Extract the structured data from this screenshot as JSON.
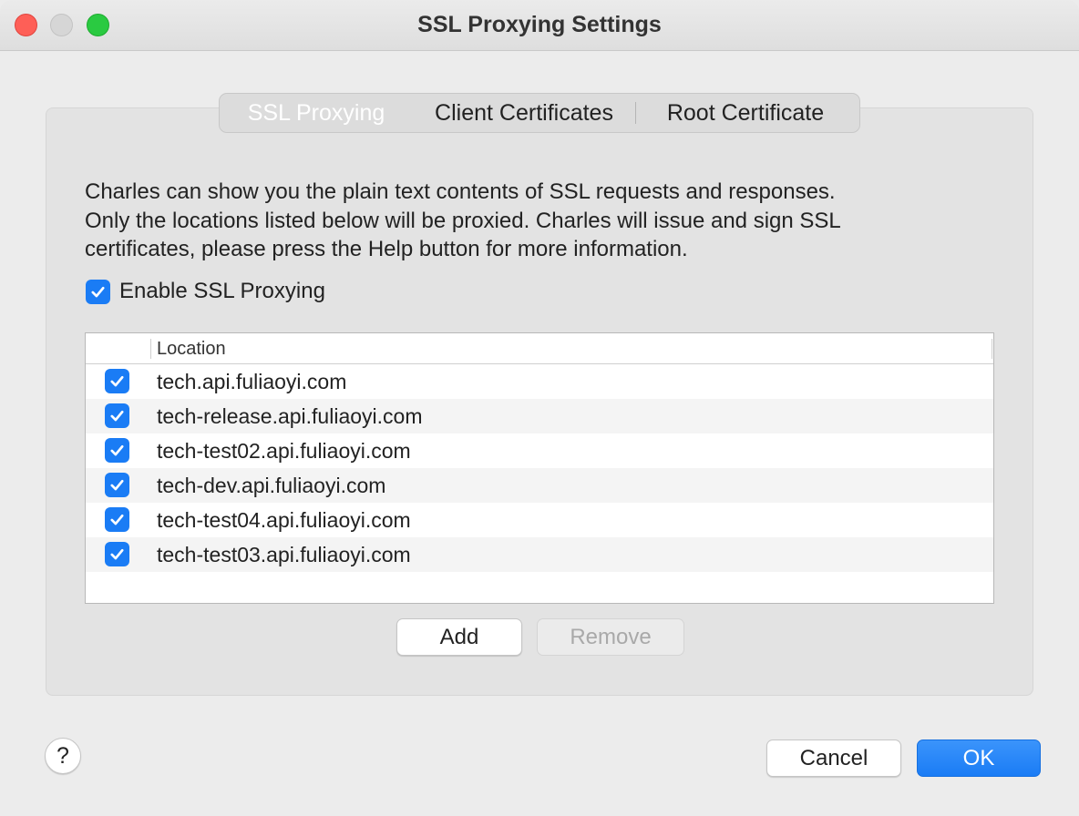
{
  "window": {
    "title": "SSL Proxying Settings"
  },
  "tabs": [
    {
      "label": "SSL Proxying",
      "active": true
    },
    {
      "label": "Client Certificates",
      "active": false
    },
    {
      "label": "Root Certificate",
      "active": false
    }
  ],
  "description": {
    "line1": "Charles can show you the plain text contents of SSL requests and responses.",
    "line2": "Only the locations listed below will be proxied. Charles will issue and sign SSL",
    "line3": "certificates, please press the Help button for more information."
  },
  "enable_ssl": {
    "label": "Enable SSL Proxying",
    "checked": true
  },
  "locations": {
    "column_header": "Location",
    "rows": [
      {
        "checked": true,
        "location": "tech.api.fuliaoyi.com"
      },
      {
        "checked": true,
        "location": "tech-release.api.fuliaoyi.com"
      },
      {
        "checked": true,
        "location": "tech-test02.api.fuliaoyi.com"
      },
      {
        "checked": true,
        "location": "tech-dev.api.fuliaoyi.com"
      },
      {
        "checked": true,
        "location": "tech-test04.api.fuliaoyi.com"
      },
      {
        "checked": true,
        "location": "tech-test03.api.fuliaoyi.com"
      }
    ]
  },
  "buttons": {
    "add": "Add",
    "remove": "Remove",
    "help": "?",
    "cancel": "Cancel",
    "ok": "OK"
  },
  "colors": {
    "accent": "#1a7cf5",
    "close": "#fe5f57",
    "maximize": "#2aca41"
  },
  "icons": {
    "checkbox": "checkmark-icon",
    "help": "question-mark-icon"
  }
}
